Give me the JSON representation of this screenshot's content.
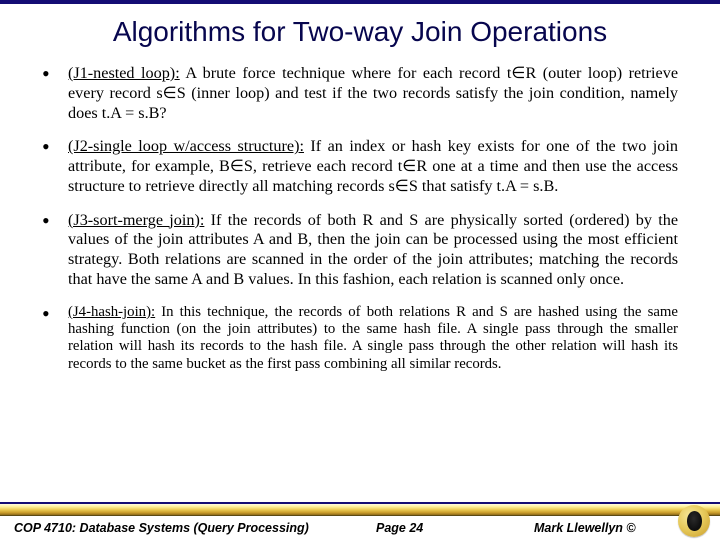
{
  "title": "Algorithms for Two-way Join Operations",
  "bullets": [
    {
      "lead": "(J1-nested loop):",
      "sep": " ",
      "body": "A brute force technique where for each record t∈R (outer loop) retrieve every record s∈S (inner loop) and test if the two records satisfy the join condition, namely does t.A = s.B?"
    },
    {
      "lead": "(J2-single loop w/access structure):",
      "sep": " ",
      "body": "If an index or hash key exists for one of the two join attribute, for example, B∈S, retrieve each record t∈R one at a time and then use the access structure to retrieve directly all matching records s∈S that satisfy t.A = s.B."
    },
    {
      "lead": "(J3-sort-merge join):",
      "sep": " ",
      "body": "If the records of both R and S are physically sorted (ordered) by the values of the join attributes A and B, then the join can be processed using the most efficient strategy.  Both relations are scanned in the order of the join attributes; matching the records that have the same A and B values.  In this fashion, each relation is scanned only once."
    },
    {
      "lead": "(J4-hash-join):",
      "sep": "  ",
      "body": "In this technique, the records of both relations R and S are hashed using the same hashing function (on the join attributes) to the same hash file.  A single pass through the smaller relation will hash its records to the hash file.  A single pass through the other relation will hash its records to the same bucket as the first pass combining all similar records."
    }
  ],
  "footer": {
    "course": "COP 4710: Database Systems (Query Processing)",
    "page": "Page 24",
    "author": "Mark Llewellyn ©"
  }
}
